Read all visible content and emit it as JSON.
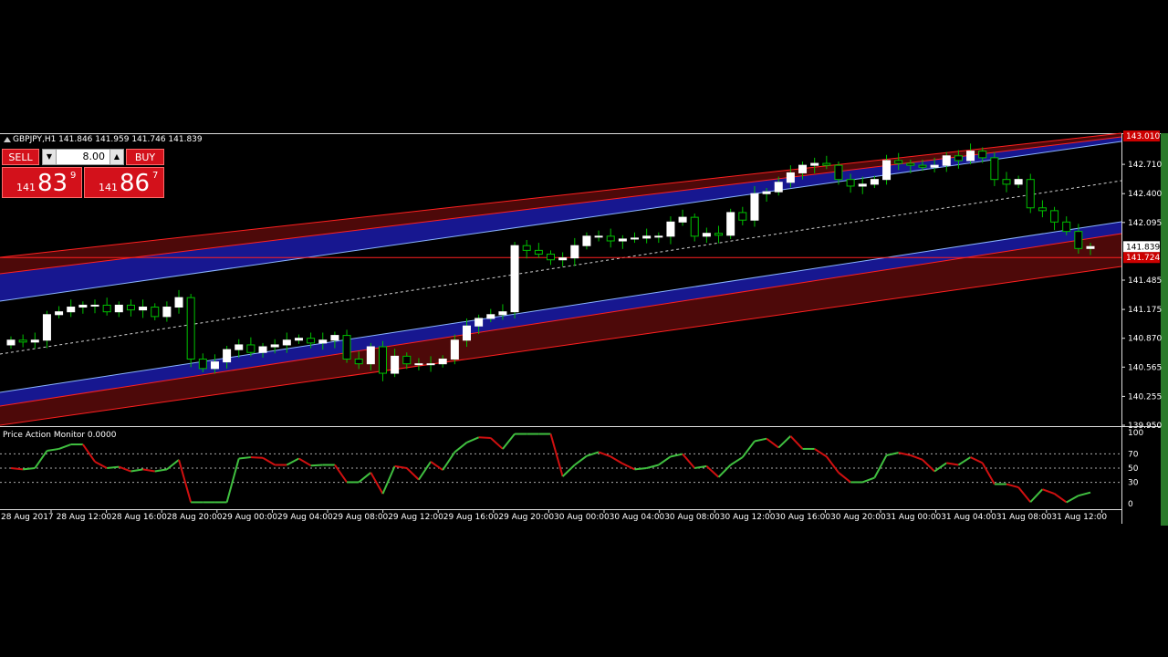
{
  "window": {
    "symbol_line": "GBPJPY,H1  141.846 141.959 141.746 141.839",
    "oscillator_title": "Price Action Monitor 0.0000"
  },
  "trade_panel": {
    "sell_label": "SELL",
    "buy_label": "BUY",
    "volume": "8.00",
    "sell_price_small": "141",
    "sell_price_big": "83",
    "sell_price_sup": "9",
    "buy_price_small": "141",
    "buy_price_big": "86",
    "buy_price_sup": "7"
  },
  "colors": {
    "background": "#000000",
    "bull_candle": "#ffffff",
    "wick": "#00c000",
    "channel_red": "#ff2020",
    "channel_blue": "#1a1aa0",
    "osc_up": "#40c040",
    "osc_down": "#d01010",
    "accent": "#d3111b"
  },
  "chart_data": [
    {
      "type": "candlestick",
      "symbol": "GBPJPY",
      "timeframe": "H1",
      "y_ticks": [
        "142.710",
        "142.400",
        "142.095",
        "141.485",
        "141.175",
        "140.870",
        "140.565",
        "140.255",
        "139.950"
      ],
      "price_labels": {
        "top_red": "143.010",
        "current": "141.839",
        "line_red": "141.724"
      },
      "ylim": [
        139.95,
        143.02
      ],
      "x_tick_labels": [
        "28 Aug 2017",
        "28 Aug 12:00",
        "28 Aug 16:00",
        "28 Aug 20:00",
        "29 Aug 00:00",
        "29 Aug 04:00",
        "29 Aug 08:00",
        "29 Aug 12:00",
        "29 Aug 16:00",
        "29 Aug 20:00",
        "30 Aug 00:00",
        "30 Aug 04:00",
        "30 Aug 08:00",
        "30 Aug 12:00",
        "30 Aug 16:00",
        "30 Aug 20:00",
        "31 Aug 00:00",
        "31 Aug 04:00",
        "31 Aug 08:00",
        "31 Aug 12:00"
      ],
      "close": [
        140.85,
        140.83,
        140.85,
        141.12,
        141.15,
        141.2,
        141.22,
        141.22,
        141.15,
        141.22,
        141.17,
        141.2,
        141.1,
        141.2,
        141.3,
        140.65,
        140.55,
        140.62,
        140.75,
        140.8,
        140.72,
        140.78,
        140.8,
        140.85,
        140.87,
        140.82,
        140.85,
        140.9,
        140.65,
        140.6,
        140.78,
        140.5,
        140.68,
        140.6,
        140.6,
        140.6,
        140.65,
        140.85,
        141.0,
        141.08,
        141.12,
        141.15,
        141.85,
        141.8,
        141.76,
        141.7,
        141.72,
        141.85,
        141.95,
        141.95,
        141.9,
        141.92,
        141.93,
        141.95,
        141.95,
        142.1,
        142.15,
        141.95,
        141.98,
        141.96,
        142.2,
        142.12,
        142.4,
        142.42,
        142.52,
        142.62,
        142.7,
        142.72,
        142.7,
        142.55,
        142.48,
        142.5,
        142.55,
        142.75,
        142.72,
        142.7,
        142.68,
        142.7,
        142.8,
        142.75,
        142.85,
        142.78,
        142.55,
        142.5,
        142.55,
        142.25,
        142.22,
        142.1,
        142.0,
        141.82,
        141.84
      ],
      "oscillator": {
        "levels": [
          100,
          70,
          50,
          30,
          0
        ],
        "ylim": [
          0,
          100
        ],
        "note_colors": "green = rising, red = falling, white dashed = neutral"
      }
    }
  ]
}
